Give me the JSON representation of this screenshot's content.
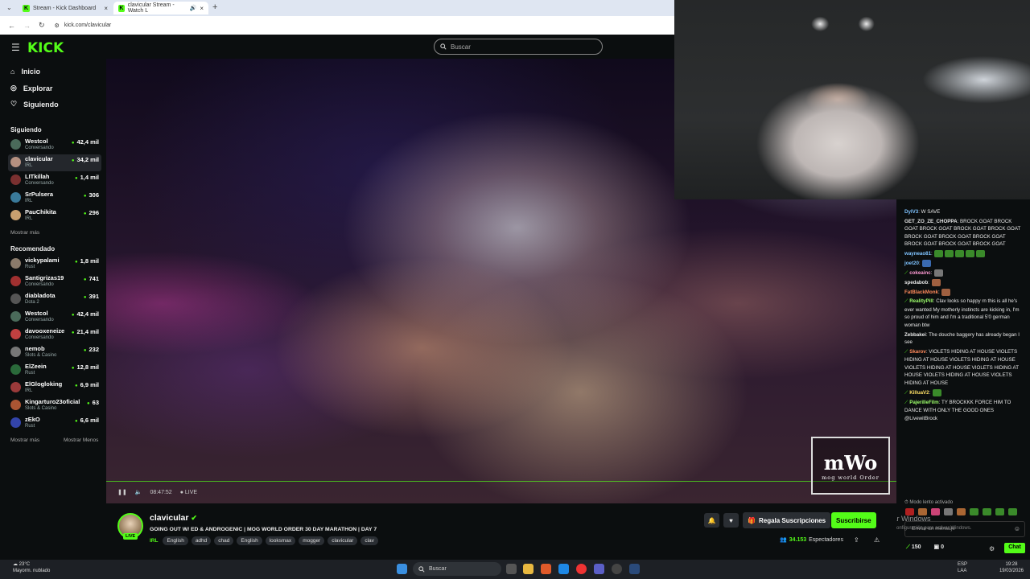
{
  "browser": {
    "tabs": [
      {
        "title": "Stream - Kick Dashboard",
        "active": false
      },
      {
        "title": "clavicular Stream - Watch L",
        "active": true
      }
    ],
    "url": "kick.com/clavicular"
  },
  "header": {
    "logo": "KICK",
    "search_placeholder": "Buscar"
  },
  "nav": {
    "items": [
      {
        "label": "Inicio",
        "icon": "home-icon"
      },
      {
        "label": "Explorar",
        "icon": "compass-icon"
      },
      {
        "label": "Siguiendo",
        "icon": "heart-icon"
      }
    ]
  },
  "following": {
    "title": "Siguiendo",
    "channels": [
      {
        "name": "Westcol",
        "category": "Conversando",
        "viewers": "42,4 mil"
      },
      {
        "name": "clavicular",
        "category": "IRL",
        "viewers": "34,2 mil",
        "selected": true
      },
      {
        "name": "LITkillah",
        "category": "Conversando",
        "viewers": "1,4 mil"
      },
      {
        "name": "SrPulsera",
        "category": "IRL",
        "viewers": "306"
      },
      {
        "name": "PauChikita",
        "category": "IRL",
        "viewers": "296"
      }
    ],
    "show_more": "Mostrar más"
  },
  "recommended": {
    "title": "Recomendado",
    "channels": [
      {
        "name": "vickypalami",
        "category": "Rust",
        "viewers": "1,8 mil"
      },
      {
        "name": "Santigrizas19",
        "category": "Conversando",
        "viewers": "741"
      },
      {
        "name": "diabladota",
        "category": "Dota 2",
        "viewers": "391"
      },
      {
        "name": "Westcol",
        "category": "Conversando",
        "viewers": "42,4 mil"
      },
      {
        "name": "davooxeneize",
        "category": "Conversando",
        "viewers": "21,4 mil"
      },
      {
        "name": "nemob",
        "category": "Slots & Casino",
        "viewers": "232"
      },
      {
        "name": "ElZeein",
        "category": "Rust",
        "viewers": "12,8 mil"
      },
      {
        "name": "ElGlogloking",
        "category": "IRL",
        "viewers": "6,9 mil"
      },
      {
        "name": "Kingarturo23oficial",
        "category": "Slots & Casino",
        "viewers": "63"
      },
      {
        "name": "zEkO",
        "category": "Rust",
        "viewers": "6,6 mil"
      }
    ],
    "show_more": "Mostrar más",
    "show_less": "Mostrar Menos"
  },
  "player": {
    "time": "08:47:52",
    "live": "LIVE",
    "watermark_big": "mWo",
    "watermark_small": "mog world Order"
  },
  "stream": {
    "streamer": "clavicular",
    "live_badge": "LIVE",
    "title": "GOING OUT W/ ED & ANDROGENIC | MOG WORLD ORDER 30 DAY MARATHON | DAY 7",
    "lang": "IRL",
    "tags": [
      "English",
      "adhd",
      "chad",
      "English",
      "looksmax",
      "mogger",
      "clavicular",
      "clav"
    ],
    "gift_label": "Regala Suscripciones",
    "subscribe_label": "Suscribirse",
    "viewers": "34.153",
    "viewers_label": "Espectadores"
  },
  "chat": {
    "messages": [
      {
        "user": "DylV3",
        "color": "#7fc3ff",
        "text": "W SAVE"
      },
      {
        "user": "GET_ZO_ZE_CHOPPA",
        "color": "#ffffff",
        "text": "BROCK GOAT BROCK GOAT BROCK GOAT BROCK GOAT BROCK GOAT BROCK GOAT BROCK GOAT BROCK GOAT BROCK GOAT BROCK GOAT BROCK GOAT"
      },
      {
        "user": "wayneao81",
        "color": "#7fc3ff",
        "text": ""
      },
      {
        "user": "joet20",
        "color": "#7fc3ff",
        "text": ""
      },
      {
        "user": "cokeainc",
        "color": "#ff9ad5",
        "text": ""
      },
      {
        "user": "spedabob",
        "color": "#ffffff",
        "text": ""
      },
      {
        "user": "FatBlackMonk",
        "color": "#ff8a5c",
        "text": ""
      },
      {
        "user": "RealityPill",
        "color": "#9dff6b",
        "text": "Clav looks so happy rn this is all he's ever wanted My motherly instincts are kicking in, I'm so proud of him and I'm a traditional 5'0 german woman btw"
      },
      {
        "user": "Zebbakei",
        "color": "#ffffff",
        "text": "The douche baggery has already began I see"
      },
      {
        "user": "Skarov",
        "color": "#ff8a5c",
        "text": "VIOLETS HIDING AT HOUSE VIOLETS HIDING AT HOUSE VIOLETS HIDING AT HOUSE VIOLETS HIDING AT HOUSE VIOLETS HIDING AT HOUSE VIOLETS HIDING AT HOUSE VIOLETS HIDING AT HOUSE"
      },
      {
        "user": "KilluaV2",
        "color": "#ffe066",
        "text": ""
      },
      {
        "user": "PajerilleFilm",
        "color": "#9dff6b",
        "text": "TY BROCKKK FORCE HIM TO DANCE WITH ONLY THE GOOD ONES @LivewitBrock"
      }
    ],
    "slow_mode": "Modo lento activado",
    "input_placeholder": "Enviar un mensaje",
    "points": "150",
    "count": "0",
    "send_label": "Chat",
    "activate_windows": "Activar Windows",
    "activate_windows_sub": "Ve a Configuración para activar Windows."
  },
  "taskbar": {
    "weather_temp": "23°C",
    "weather_desc": "Mayorm. nublado",
    "search": "Buscar",
    "lang_top": "ESP",
    "lang_bottom": "LAA",
    "time": "19:28",
    "date": "19/03/2026"
  }
}
